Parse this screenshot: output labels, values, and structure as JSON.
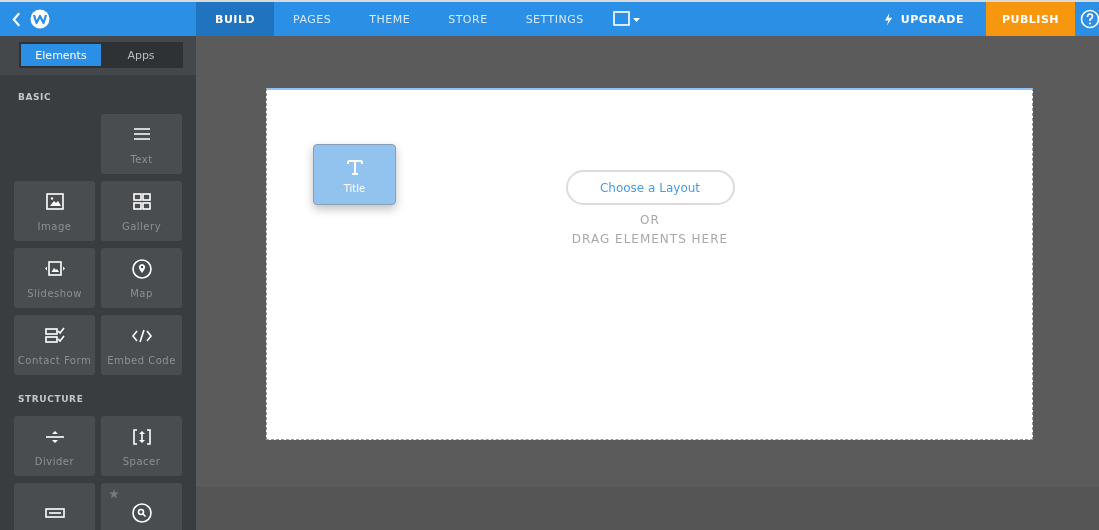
{
  "topbar": {
    "nav": [
      {
        "label": "BUILD",
        "selected": true
      },
      {
        "label": "PAGES",
        "selected": false
      },
      {
        "label": "THEME",
        "selected": false
      },
      {
        "label": "STORE",
        "selected": false
      },
      {
        "label": "SETTINGS",
        "selected": false
      }
    ],
    "upgrade": "UPGRADE",
    "publish": "PUBLISH"
  },
  "sidebar": {
    "tabs": [
      {
        "label": "Elements",
        "selected": true
      },
      {
        "label": "Apps",
        "selected": false
      }
    ],
    "sections": [
      {
        "title": "BASIC",
        "items": [
          {
            "kind": "empty"
          },
          {
            "kind": "text",
            "label": "Text"
          },
          {
            "kind": "image",
            "label": "Image"
          },
          {
            "kind": "gallery",
            "label": "Gallery"
          },
          {
            "kind": "slideshow",
            "label": "Slideshow"
          },
          {
            "kind": "map",
            "label": "Map"
          },
          {
            "kind": "form",
            "label": "Contact Form"
          },
          {
            "kind": "embed",
            "label": "Embed Code"
          }
        ]
      },
      {
        "title": "STRUCTURE",
        "items": [
          {
            "kind": "divider",
            "label": "Divider"
          },
          {
            "kind": "spacer",
            "label": "Spacer"
          },
          {
            "kind": "button",
            "starred": false
          },
          {
            "kind": "search",
            "starred": true
          }
        ]
      }
    ]
  },
  "canvas": {
    "dragged": {
      "kind": "title",
      "label": "Title"
    },
    "layout_button": "Choose a Layout",
    "or": "OR",
    "hint": "DRAG ELEMENTS HERE"
  }
}
